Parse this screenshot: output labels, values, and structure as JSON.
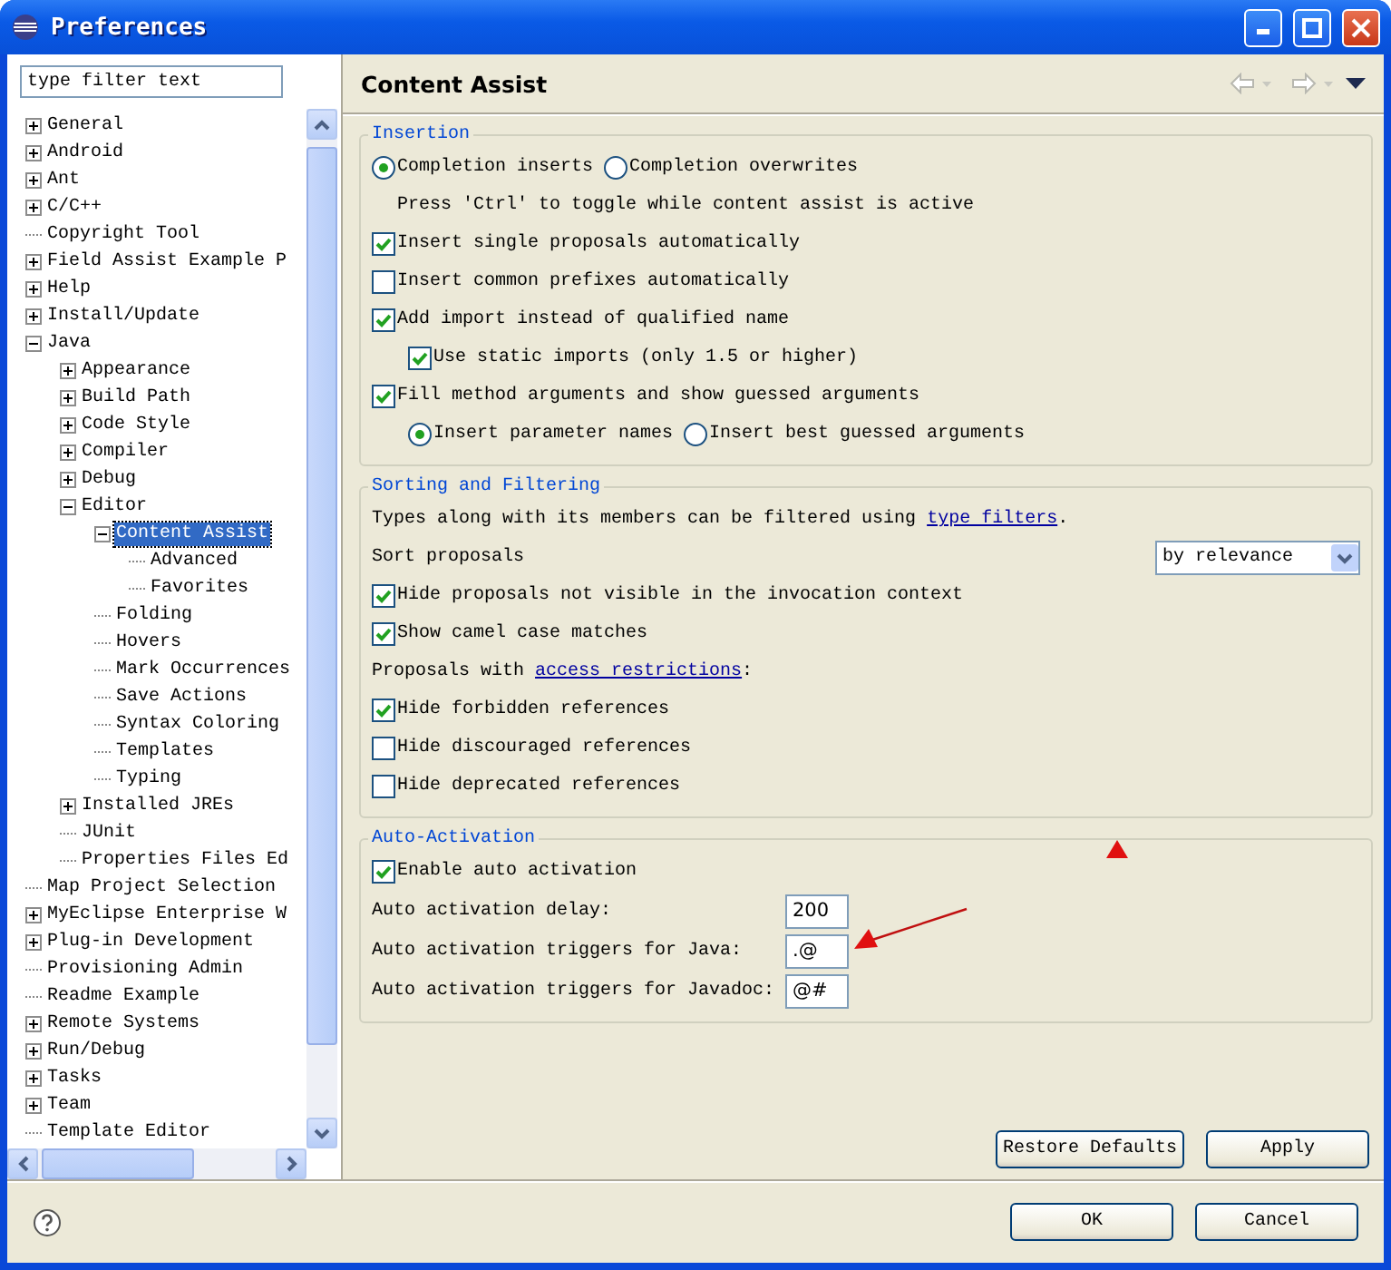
{
  "window": {
    "title": "Preferences"
  },
  "filter": {
    "placeholder": "type filter text"
  },
  "tree": [
    {
      "label": "General",
      "expanded": false,
      "selected": false
    },
    {
      "label": "Android",
      "expanded": false,
      "selected": false
    },
    {
      "label": "Ant",
      "expanded": false,
      "selected": false
    },
    {
      "label": "C/C++",
      "expanded": false,
      "selected": false
    },
    {
      "label": "Copyright Tool",
      "selected": false
    },
    {
      "label": "Field Assist Example P",
      "expanded": false,
      "selected": false
    },
    {
      "label": "Help",
      "expanded": false,
      "selected": false
    },
    {
      "label": "Install/Update",
      "expanded": false,
      "selected": false
    },
    {
      "label": "Java",
      "expanded": true,
      "selected": false,
      "children": [
        {
          "label": "Appearance",
          "expanded": false,
          "selected": false
        },
        {
          "label": "Build Path",
          "expanded": false,
          "selected": false
        },
        {
          "label": "Code Style",
          "expanded": false,
          "selected": false
        },
        {
          "label": "Compiler",
          "expanded": false,
          "selected": false
        },
        {
          "label": "Debug",
          "expanded": false,
          "selected": false
        },
        {
          "label": "Editor",
          "expanded": true,
          "selected": false,
          "children": [
            {
              "label": "Content Assist",
              "expanded": true,
              "selected": true,
              "children": [
                {
                  "label": "Advanced",
                  "selected": false
                },
                {
                  "label": "Favorites",
                  "selected": false
                }
              ]
            },
            {
              "label": "Folding",
              "selected": false
            },
            {
              "label": "Hovers",
              "selected": false
            },
            {
              "label": "Mark Occurrences",
              "selected": false
            },
            {
              "label": "Save Actions",
              "selected": false
            },
            {
              "label": "Syntax Coloring",
              "selected": false
            },
            {
              "label": "Templates",
              "selected": false
            },
            {
              "label": "Typing",
              "selected": false
            }
          ]
        },
        {
          "label": "Installed JREs",
          "expanded": false,
          "selected": false
        },
        {
          "label": "JUnit",
          "selected": false
        },
        {
          "label": "Properties Files Ed",
          "selected": false
        }
      ]
    },
    {
      "label": "Map Project Selection",
      "selected": false
    },
    {
      "label": "MyEclipse Enterprise W",
      "expanded": false,
      "selected": false
    },
    {
      "label": "Plug-in Development",
      "expanded": false,
      "selected": false
    },
    {
      "label": "Provisioning Admin",
      "selected": false
    },
    {
      "label": "Readme Example",
      "selected": false
    },
    {
      "label": "Remote Systems",
      "expanded": false,
      "selected": false
    },
    {
      "label": "Run/Debug",
      "expanded": false,
      "selected": false
    },
    {
      "label": "Tasks",
      "expanded": false,
      "selected": false
    },
    {
      "label": "Team",
      "expanded": false,
      "selected": false
    },
    {
      "label": "Template Editor",
      "selected": false
    }
  ],
  "page": {
    "title": "Content Assist",
    "groups": [
      {
        "title": "Insertion",
        "items": [
          {
            "kind": "radios",
            "options": [
              {
                "label": "Completion inserts",
                "selected": true
              },
              {
                "label": "Completion overwrites",
                "selected": false
              }
            ]
          },
          {
            "kind": "note",
            "text": "Press 'Ctrl' to toggle while content assist is active"
          },
          {
            "kind": "checkbox",
            "label": "Insert single proposals automatically",
            "checked": true
          },
          {
            "kind": "checkbox",
            "label": "Insert common prefixes automatically",
            "checked": false
          },
          {
            "kind": "checkbox",
            "label": "Add import instead of qualified name",
            "checked": true,
            "children": [
              {
                "kind": "checkbox",
                "label": "Use static imports (only 1.5 or higher)",
                "checked": true
              }
            ]
          },
          {
            "kind": "checkbox",
            "label": "Fill method arguments and show guessed arguments",
            "checked": true,
            "children": [
              {
                "kind": "radios",
                "options": [
                  {
                    "label": "Insert parameter names",
                    "selected": true
                  },
                  {
                    "label": "Insert best guessed arguments",
                    "selected": false
                  }
                ]
              }
            ]
          }
        ]
      },
      {
        "title": "Sorting and Filtering",
        "items": [
          {
            "kind": "link_text",
            "before": "Types along with its members can be filtered using ",
            "link": "type filters",
            "after": "."
          },
          {
            "kind": "select",
            "label": "Sort proposals",
            "value": "by relevance"
          },
          {
            "kind": "checkbox",
            "label": "Hide proposals not visible in the invocation context",
            "checked": true
          },
          {
            "kind": "checkbox",
            "label": "Show camel case matches",
            "checked": true
          },
          {
            "kind": "link_text",
            "before": "Proposals with ",
            "link": "access restrictions",
            "after": ":"
          },
          {
            "kind": "checkbox",
            "label": "Hide forbidden references",
            "checked": true
          },
          {
            "kind": "checkbox",
            "label": "Hide discouraged references",
            "checked": false
          },
          {
            "kind": "checkbox",
            "label": "Hide deprecated references",
            "checked": false
          }
        ]
      },
      {
        "title": "Auto-Activation",
        "items": [
          {
            "kind": "checkbox",
            "label": "Enable auto activation",
            "checked": true
          },
          {
            "kind": "field",
            "label": "Auto activation delay:",
            "value": "200"
          },
          {
            "kind": "field",
            "label": "Auto activation triggers for Java:",
            "value": ".@"
          },
          {
            "kind": "field",
            "label": "Auto activation triggers for Javadoc:",
            "value": "@#"
          }
        ]
      }
    ],
    "buttons": [
      "Restore Defaults",
      "Apply"
    ]
  },
  "dialog_buttons": [
    "OK",
    "Cancel"
  ]
}
